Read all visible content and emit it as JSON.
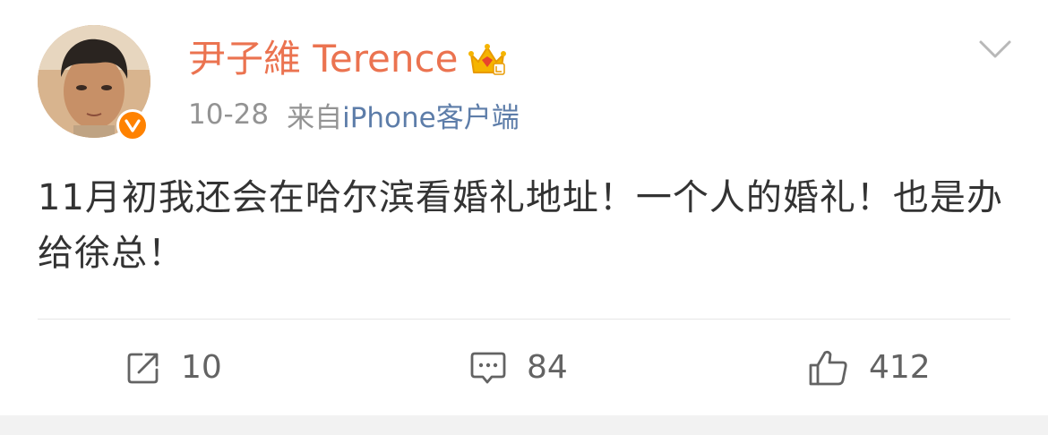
{
  "post": {
    "author": {
      "name": "尹子維 Terence",
      "verified_badge_icon": "verified-v-icon",
      "member_icon": "crown-icon"
    },
    "meta": {
      "time": "10-28",
      "from_label": "来自",
      "source": "iPhone客户端"
    },
    "text": "11月初我还会在哈尔滨看婚礼地址！一个人的婚礼！也是办给徐总！",
    "actions": {
      "repost_count": "10",
      "comment_count": "84",
      "like_count": "412"
    },
    "colors": {
      "username": "#eb7350",
      "source_link": "#5d7da9",
      "verified_badge": "#ff8200",
      "meta_gray": "#939393"
    }
  }
}
